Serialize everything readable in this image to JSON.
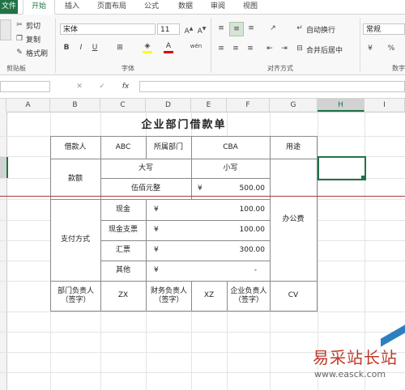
{
  "tabs": [
    "文件",
    "开始",
    "插入",
    "页面布局",
    "公式",
    "数据",
    "审阅",
    "视图"
  ],
  "clipboard": {
    "cut": "剪切",
    "copy": "复制",
    "painter": "格式刷",
    "group": "剪贴板"
  },
  "font": {
    "name": "宋体",
    "size": "11",
    "bold": "B",
    "italic": "I",
    "underline": "U",
    "group": "字体"
  },
  "align": {
    "wrap": "自动换行",
    "merge": "合并后居中",
    "group": "对齐方式"
  },
  "number": {
    "format": "常规",
    "group": "数字"
  },
  "formula": {
    "fx": "fx",
    "cancel": "✕",
    "enter": "✓"
  },
  "columns": [
    "A",
    "B",
    "C",
    "D",
    "E",
    "F",
    "G",
    "H",
    "I"
  ],
  "sheet": {
    "title": "企业部门借款单",
    "borrower_label": "借款人",
    "borrower": "ABC",
    "dept_label": "所属部门",
    "dept": "CBA",
    "purpose_label": "用途",
    "amount_label": "款额",
    "upper_label": "大写",
    "lower_label": "小写",
    "upper_value": "伍佰元整",
    "lower_currency": "¥",
    "lower_value": "500.00",
    "pay_label": "支付方式",
    "pay_rows": [
      {
        "method": "现金",
        "currency": "¥",
        "amount": "100.00"
      },
      {
        "method": "现金支票",
        "currency": "¥",
        "amount": "100.00"
      },
      {
        "method": "汇票",
        "currency": "¥",
        "amount": "300.00"
      },
      {
        "method": "其他",
        "currency": "¥",
        "amount": "-"
      }
    ],
    "purpose_value": "办公费",
    "sig": [
      {
        "label": "部门负责人（签字）",
        "value": "ZX"
      },
      {
        "label": "财务负责人（签字）",
        "value": "XZ"
      },
      {
        "label": "企业负责人（签字）",
        "value": "CV"
      }
    ]
  },
  "watermark": {
    "title": "易采站长站",
    "url": "www.easck.com"
  }
}
